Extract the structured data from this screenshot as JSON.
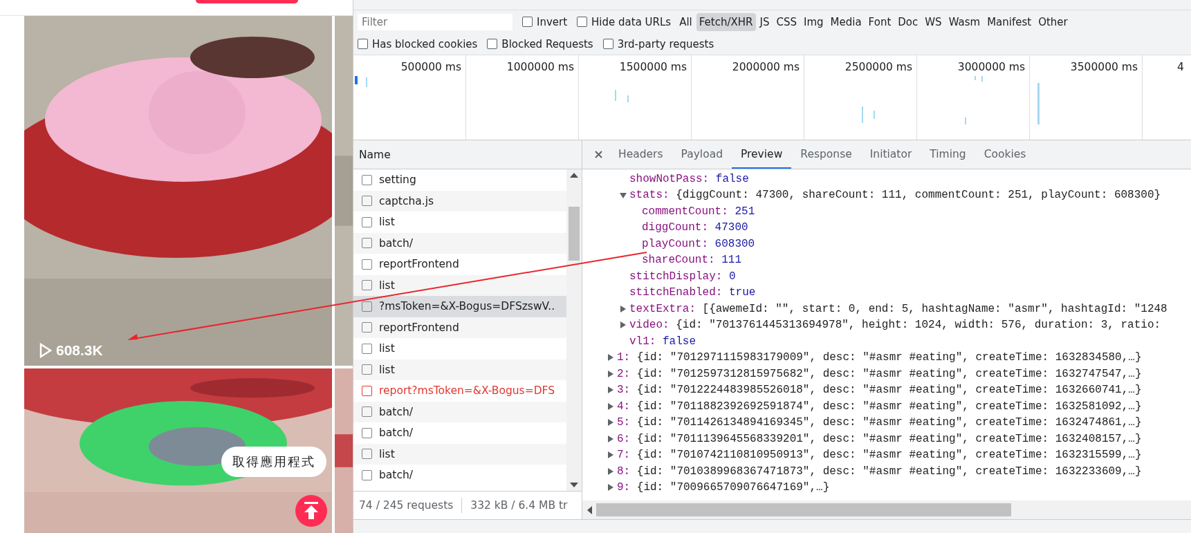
{
  "page": {
    "feed": [
      {
        "kind": "picture",
        "play_count": "608.3K"
      },
      {
        "kind": "picture"
      }
    ],
    "app_prompt": "取得應用程式"
  },
  "devtools": {
    "filter": {
      "placeholder": "Filter"
    },
    "filter_options": [
      {
        "label": "Invert",
        "checked": false
      },
      {
        "label": "Hide data URLs",
        "checked": false
      }
    ],
    "type_filters": [
      {
        "label": "All",
        "selected": false
      },
      {
        "label": "Fetch/XHR",
        "selected": true
      },
      {
        "label": "JS",
        "selected": false
      },
      {
        "label": "CSS",
        "selected": false
      },
      {
        "label": "Img",
        "selected": false
      },
      {
        "label": "Media",
        "selected": false
      },
      {
        "label": "Font",
        "selected": false
      },
      {
        "label": "Doc",
        "selected": false
      },
      {
        "label": "WS",
        "selected": false
      },
      {
        "label": "Wasm",
        "selected": false
      },
      {
        "label": "Manifest",
        "selected": false
      },
      {
        "label": "Other",
        "selected": false
      }
    ],
    "more_options": [
      {
        "label": "Has blocked cookies",
        "checked": false
      },
      {
        "label": "Blocked Requests",
        "checked": false
      },
      {
        "label": "3rd-party requests",
        "checked": false
      }
    ],
    "timeline": {
      "ticks": [
        "500000 ms",
        "1000000 ms",
        "1500000 ms",
        "2000000 ms",
        "2500000 ms",
        "3000000 ms",
        "3500000 ms",
        "4"
      ]
    },
    "requests": {
      "column": "Name",
      "rows": [
        {
          "name": "setting",
          "selected": false,
          "failed": false
        },
        {
          "name": "captcha.js",
          "selected": false,
          "failed": false
        },
        {
          "name": "list",
          "selected": false,
          "failed": false
        },
        {
          "name": "batch/",
          "selected": false,
          "failed": false
        },
        {
          "name": "reportFrontend",
          "selected": false,
          "failed": false
        },
        {
          "name": "list",
          "selected": false,
          "failed": false
        },
        {
          "name": "?msToken=&X-Bogus=DFSzswV..",
          "selected": true,
          "failed": false
        },
        {
          "name": "reportFrontend",
          "selected": false,
          "failed": false
        },
        {
          "name": "list",
          "selected": false,
          "failed": false
        },
        {
          "name": "list",
          "selected": false,
          "failed": false
        },
        {
          "name": "report?msToken=&X-Bogus=DFS",
          "selected": false,
          "failed": true
        },
        {
          "name": "batch/",
          "selected": false,
          "failed": false
        },
        {
          "name": "batch/",
          "selected": false,
          "failed": false
        },
        {
          "name": "list",
          "selected": false,
          "failed": false
        },
        {
          "name": "batch/",
          "selected": false,
          "failed": false
        }
      ],
      "summary": [
        "74 / 245 requests",
        "332 kB / 6.4 MB tr"
      ]
    },
    "detail_tabs": [
      {
        "label": "Headers",
        "selected": false
      },
      {
        "label": "Payload",
        "selected": false
      },
      {
        "label": "Preview",
        "selected": true
      },
      {
        "label": "Response",
        "selected": false
      },
      {
        "label": "Initiator",
        "selected": false
      },
      {
        "label": "Timing",
        "selected": false
      },
      {
        "label": "Cookies",
        "selected": false
      }
    ],
    "preview": [
      {
        "children": [
          {
            "key": "showNotPass:",
            "value": "false",
            "kind": "literal"
          },
          {
            "key": "stats:",
            "value": "{diggCount: 47300, shareCount: 111, commentCount: 251, playCount: 608300}",
            "kind": "preview",
            "expanded": true,
            "children": [
              {
                "key": "commentCount:",
                "value": "251",
                "kind": "literal"
              },
              {
                "key": "diggCount:",
                "value": "47300",
                "kind": "literal"
              },
              {
                "key": "playCount:",
                "value": "608300",
                "kind": "literal"
              },
              {
                "key": "shareCount:",
                "value": "111",
                "kind": "literal"
              }
            ]
          },
          {
            "key": "stitchDisplay:",
            "value": "0",
            "kind": "literal"
          },
          {
            "key": "stitchEnabled:",
            "value": "true",
            "kind": "literal"
          },
          {
            "key": "textExtra:",
            "value": "[{awemeId: \"\", start: 0, end: 5, hashtagName: \"asmr\", hashtagId: \"1248",
            "kind": "preview",
            "expanded": false
          },
          {
            "key": "video:",
            "value": "{id: \"7013761445313694978\", height: 1024, width: 576, duration: 3, ratio:",
            "kind": "preview",
            "expanded": false
          },
          {
            "key": "vl1:",
            "value": "false",
            "kind": "literal"
          }
        ]
      },
      {
        "key": "1:",
        "value": "{id: \"7012971115983179009\", desc: \"#asmr #eating\", createTime: 1632834580,…}",
        "kind": "preview",
        "expanded": false
      },
      {
        "key": "2:",
        "value": "{id: \"7012597312815975682\", desc: \"#asmr #eating\", createTime: 1632747547,…}",
        "kind": "preview",
        "expanded": false
      },
      {
        "key": "3:",
        "value": "{id: \"7012224483985526018\", desc: \"#asmr #eating\", createTime: 1632660741,…}",
        "kind": "preview",
        "expanded": false
      },
      {
        "key": "4:",
        "value": "{id: \"7011882392692591874\", desc: \"#asmr #eating\", createTime: 1632581092,…}",
        "kind": "preview",
        "expanded": false
      },
      {
        "key": "5:",
        "value": "{id: \"7011426134894169345\", desc: \"#asmr #eating\", createTime: 1632474861,…}",
        "kind": "preview",
        "expanded": false
      },
      {
        "key": "6:",
        "value": "{id: \"7011139645568339201\", desc: \"#asmr #eating\", createTime: 1632408157,…}",
        "kind": "preview",
        "expanded": false
      },
      {
        "key": "7:",
        "value": "{id: \"7010742110810950913\", desc: \"#asmr #eating\", createTime: 1632315599,…}",
        "kind": "preview",
        "expanded": false
      },
      {
        "key": "8:",
        "value": "{id: \"7010389968367471873\", desc: \"#asmr #eating\", createTime: 1632233609,…}",
        "kind": "preview",
        "expanded": false
      },
      {
        "key": "9:",
        "value": "{id: \"7009665709076647169\",…}",
        "kind": "preview",
        "expanded": false
      }
    ]
  }
}
